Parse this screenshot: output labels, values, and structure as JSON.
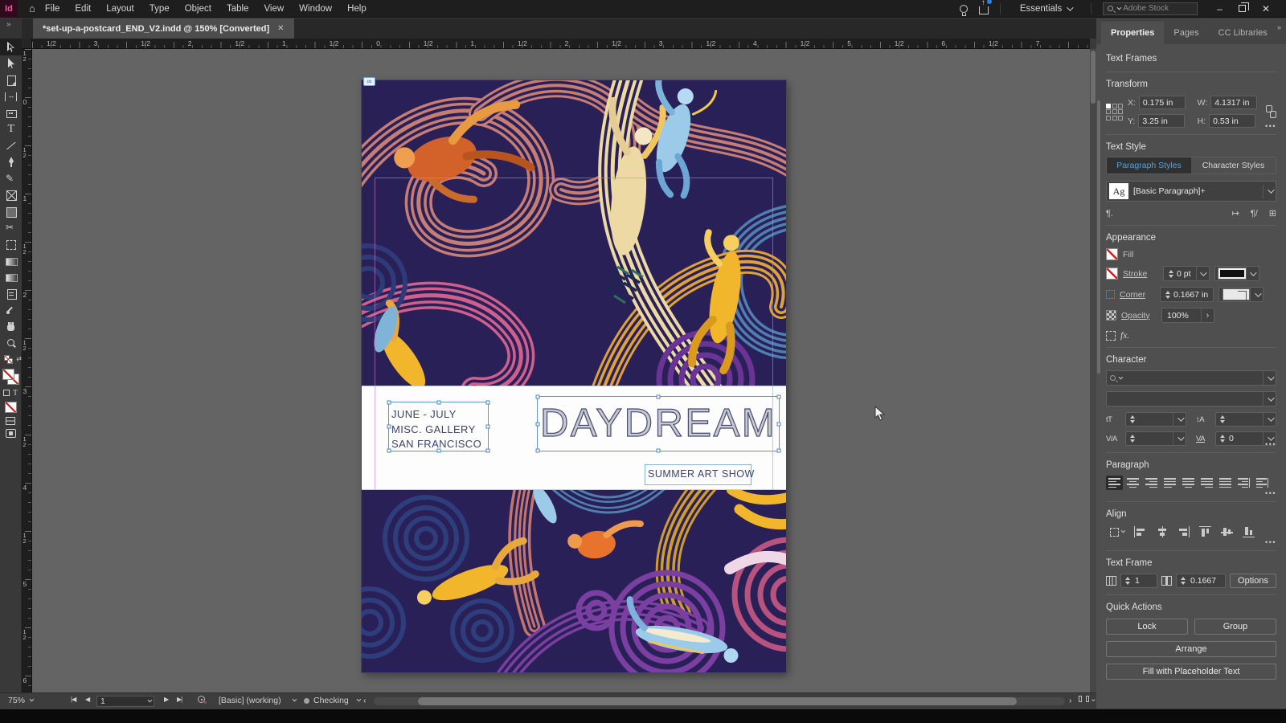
{
  "menubar": {
    "menus": [
      "File",
      "Edit",
      "Layout",
      "Type",
      "Object",
      "Table",
      "View",
      "Window",
      "Help"
    ],
    "workspace_label": "Essentials",
    "search_placeholder": "Adobe Stock",
    "logo_text": "Id"
  },
  "tab": {
    "title": "*set-up-a-postcard_END_V2.indd @ 150% [Converted]"
  },
  "toolbar": {
    "tools": [
      {
        "name": "selection-tool",
        "selected": true
      },
      {
        "name": "direct-selection-tool"
      },
      {
        "name": "page-tool"
      },
      {
        "name": "gap-tool"
      },
      {
        "name": "content-collector-tool"
      },
      {
        "name": "type-tool"
      },
      {
        "name": "line-tool"
      },
      {
        "name": "pen-tool"
      },
      {
        "name": "pencil-tool"
      },
      {
        "name": "rectangle-frame-tool"
      },
      {
        "name": "rectangle-tool"
      },
      {
        "name": "scissors-tool"
      },
      {
        "name": "free-transform-tool"
      },
      {
        "name": "gradient-swatch-tool"
      },
      {
        "name": "gradient-feather-tool"
      },
      {
        "name": "note-tool"
      },
      {
        "name": "eyedropper-tool"
      },
      {
        "name": "hand-tool"
      },
      {
        "name": "zoom-tool"
      }
    ]
  },
  "rulers": {
    "horizontal": [
      "1/2",
      "3",
      "1/2",
      "2",
      "1/2",
      "1",
      "1/2",
      "0",
      "1/2",
      "1",
      "1/2",
      "2",
      "1/2",
      "3",
      "1/2",
      "4",
      "1/2",
      "5",
      "1/2",
      "6",
      "1/2",
      "7"
    ],
    "vertical": [
      "1/2",
      "0",
      "1/2",
      "1",
      "1/2",
      "2",
      "1/2",
      "3",
      "1/2",
      "4",
      "1/2",
      "5",
      "1/2",
      "6"
    ]
  },
  "canvas": {
    "postcard": {
      "info_line1": "JUNE - JULY",
      "info_line2": "MISC. GALLERY",
      "info_line3": "SAN FRANCISCO",
      "title": "DAYDREAM",
      "subtitle": "SUMMER ART SHOW"
    },
    "art_palette": {
      "background": "#2a2058",
      "salmon": "#c67d74",
      "pink": "#cf5f8c",
      "purple": "#6a3496",
      "navy": "#2f3a78",
      "blue": "#4e7fb0",
      "cream": "#ecd9a4",
      "gold": "#dfa23a",
      "yellow": "#f2b62c",
      "orange": "#d2622a",
      "light_blue": "#9ccbe9"
    },
    "link_badge_glyph": "∞"
  },
  "panel": {
    "tabs": [
      "Properties",
      "Pages",
      "CC Libraries"
    ],
    "overflow_glyph": "»",
    "selection_type": "Text Frames",
    "transform": {
      "label": "Transform",
      "x_label": "X:",
      "x_value": "0.175 in",
      "y_label": "Y:",
      "y_value": "3.25 in",
      "w_label": "W:",
      "w_value": "4.1317 in",
      "h_label": "H:",
      "h_value": "0.53 in"
    },
    "text_style": {
      "label": "Text Style",
      "tab_paragraph": "Paragraph Styles",
      "tab_character": "Character Styles",
      "style_thumb": "Ag",
      "style_name": "[Basic Paragraph]+",
      "icon_glyphs": [
        "¶.",
        "↦",
        "¶/",
        "⊞"
      ]
    },
    "appearance": {
      "label": "Appearance",
      "fill_label": "Fill",
      "stroke_label": "Stroke",
      "stroke_value": "0 pt",
      "corner_label": "Corner",
      "corner_value": "0.1667 in",
      "opacity_label": "Opacity",
      "opacity_value": "100%",
      "opacity_expand_glyph": "›",
      "fx_glyph": "fx."
    },
    "character": {
      "label": "Character",
      "font_size_glyph": "tT",
      "leading_glyph": "↕A",
      "kerning_glyph": "V/A",
      "tracking_glyph": "VA",
      "tracking_value": "0"
    },
    "paragraph": {
      "label": "Paragraph",
      "buttons": [
        "align-left",
        "align-center",
        "align-right",
        "justify-left",
        "justify-center",
        "justify-right",
        "justify-all",
        "toward-spine",
        "away-spine"
      ]
    },
    "align": {
      "label": "Align",
      "buttons": [
        "align-left-edges",
        "align-h-centers",
        "align-right-edges",
        "align-top-edges",
        "align-v-centers",
        "align-bottom-edges"
      ]
    },
    "text_frame": {
      "label": "Text Frame",
      "columns_value": "1",
      "gutter_value": "0.1667",
      "options_label": "Options"
    },
    "quick_actions": {
      "label": "Quick Actions",
      "buttons": [
        "Lock",
        "Group",
        "Arrange",
        "Fill with Placeholder Text"
      ]
    },
    "more_glyph": "•••"
  },
  "statusbar": {
    "zoom_level": "75%",
    "first_page_glyph": "|◀",
    "prev_page_glyph": "◀",
    "page_number": "1",
    "next_page_glyph": "▶",
    "last_page_glyph": "▶|",
    "preset": "[Basic] (working)",
    "preflight_status": "Checking",
    "scroll_left_glyph": "‹",
    "scroll_right_glyph": "›"
  },
  "glyphs": {
    "home": "⌂",
    "overflow": "»",
    "tab_close": "✕",
    "window_minimize": "–",
    "window_close": "✕",
    "swap_arrow": "⇄",
    "vscroll_chevron": "⌄"
  }
}
